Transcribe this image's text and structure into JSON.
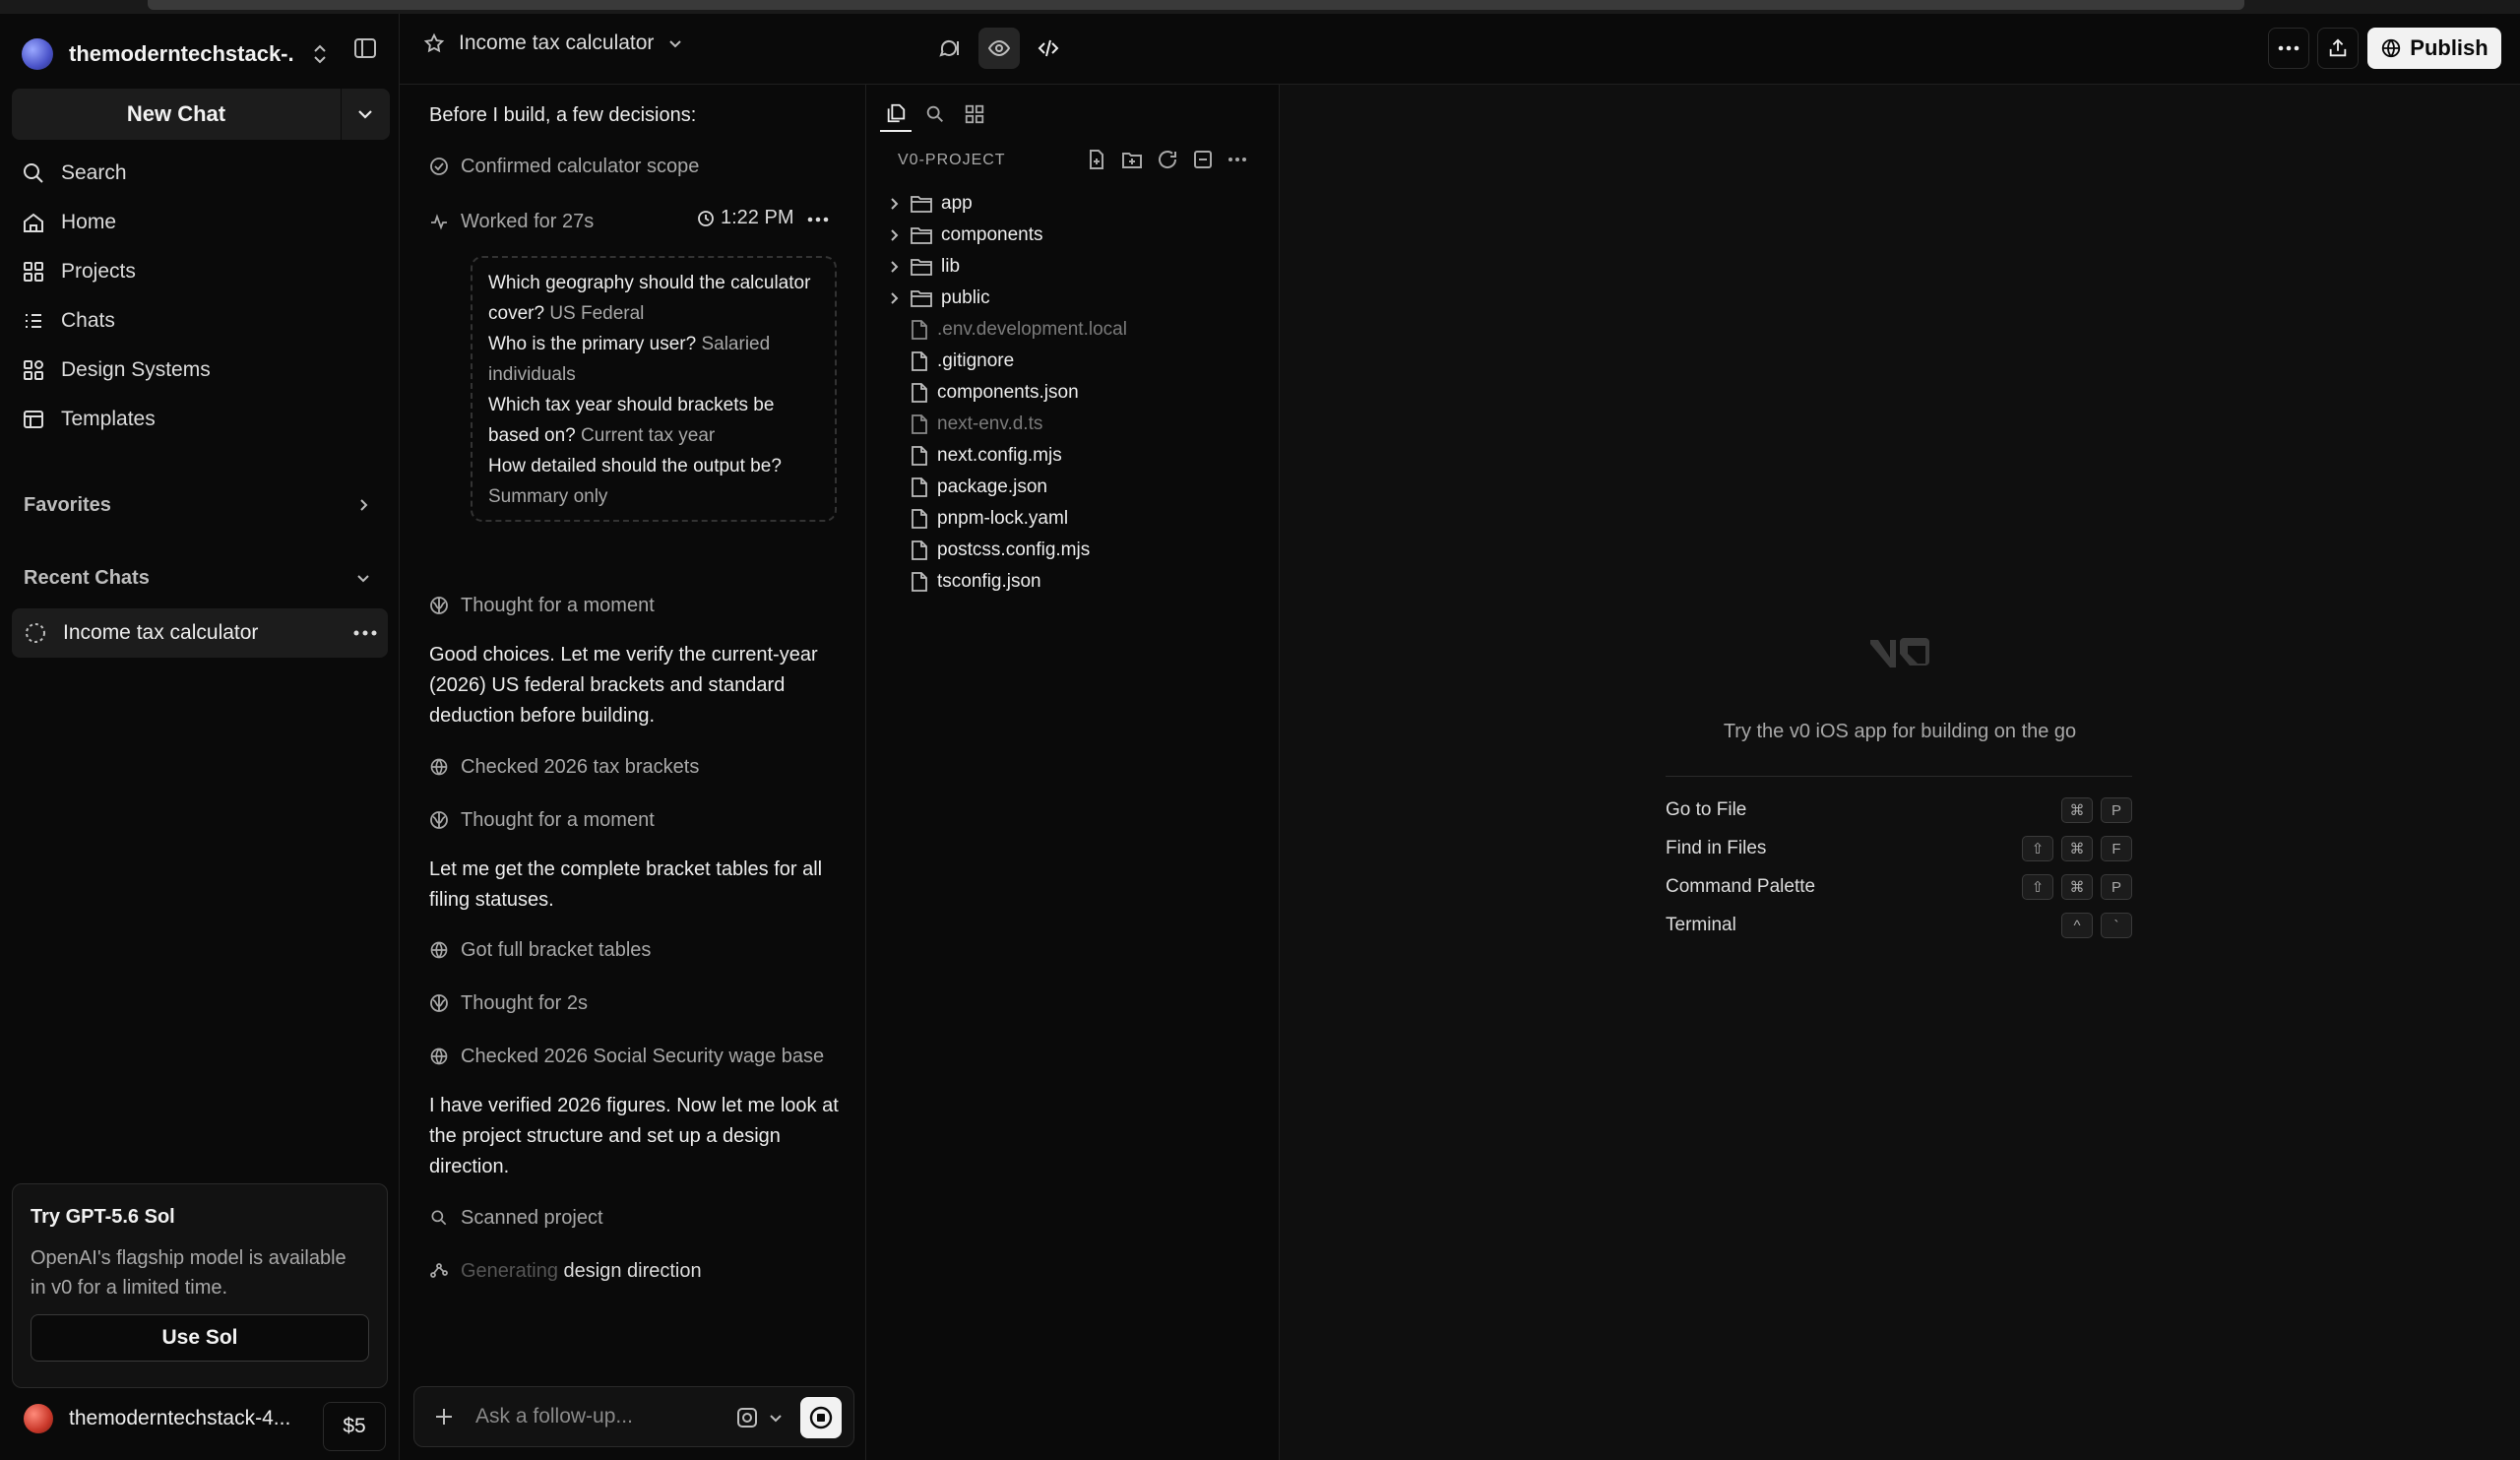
{
  "sidebar": {
    "workspace": "themoderntechstack-...",
    "new_chat": "New Chat",
    "nav": [
      "Search",
      "Home",
      "Projects",
      "Chats",
      "Design Systems",
      "Templates"
    ],
    "favorites": "Favorites",
    "recent_chats": "Recent Chats",
    "recent_items": [
      "Income tax calculator"
    ],
    "promo": {
      "title": "Try GPT-5.6 Sol",
      "desc": "OpenAI's flagship model is available in v0 for a limited time.",
      "button": "Use Sol"
    },
    "user": "themoderntechstack-4...",
    "credits": "$5"
  },
  "header": {
    "title": "Income tax calculator",
    "publish": "Publish"
  },
  "chat": {
    "intro": "Before I build, a few decisions:",
    "confirmed": "Confirmed calculator scope",
    "worked": "Worked for 27s",
    "time": "1:22 PM",
    "questions": [
      {
        "q": "Which geography should the calculator cover?",
        "a": "US Federal"
      },
      {
        "q": "Who is the primary user?",
        "a": "Salaried individuals"
      },
      {
        "q": "Which tax year should brackets be based on?",
        "a": "Current tax year"
      },
      {
        "q": "How detailed should the output be?",
        "a": "Summary only"
      }
    ],
    "thought1": "Thought for a moment",
    "msg1": "Good choices. Let me verify the current-year (2026) US federal brackets and standard deduction before building.",
    "checked1": "Checked 2026 tax brackets",
    "thought2": "Thought for a moment",
    "msg2": "Let me get the complete bracket tables for all filing statuses.",
    "got": "Got full bracket tables",
    "thought3": "Thought for 2s",
    "checked2": "Checked 2026 Social Security wage base",
    "msg3": "I have verified 2026 figures. Now let me look at the project structure and set up a design direction.",
    "scanned": "Scanned project",
    "generating_a": "Generating",
    "generating_b": "design direction",
    "placeholder": "Ask a follow-up..."
  },
  "files": {
    "project": "V0-PROJECT",
    "folders": [
      "app",
      "components",
      "lib",
      "public"
    ],
    "files": [
      {
        "name": ".env.development.local",
        "dim": true
      },
      {
        "name": ".gitignore",
        "dim": false
      },
      {
        "name": "components.json",
        "dim": false
      },
      {
        "name": "next-env.d.ts",
        "dim": true
      },
      {
        "name": "next.config.mjs",
        "dim": false
      },
      {
        "name": "package.json",
        "dim": false
      },
      {
        "name": "pnpm-lock.yaml",
        "dim": false
      },
      {
        "name": "postcss.config.mjs",
        "dim": false
      },
      {
        "name": "tsconfig.json",
        "dim": false
      }
    ]
  },
  "editor": {
    "tip": "Try the v0 iOS app for building on the go",
    "shortcuts": [
      {
        "label": "Go to File",
        "keys": [
          "⌘",
          "P"
        ]
      },
      {
        "label": "Find in Files",
        "keys": [
          "⇧",
          "⌘",
          "F"
        ]
      },
      {
        "label": "Command Palette",
        "keys": [
          "⇧",
          "⌘",
          "P"
        ]
      },
      {
        "label": "Terminal",
        "keys": [
          "^",
          "`"
        ]
      }
    ]
  }
}
